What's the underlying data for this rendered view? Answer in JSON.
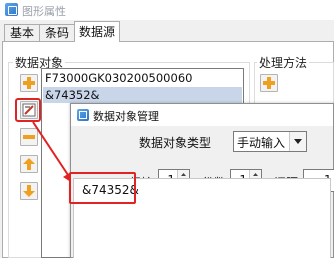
{
  "window": {
    "title": "图形属性",
    "icon": "properties-icon"
  },
  "tabs": [
    {
      "label": "基本",
      "active": false
    },
    {
      "label": "条码",
      "active": false
    },
    {
      "label": "数据源",
      "active": true
    }
  ],
  "data_objects": {
    "group_label": "数据对象",
    "items": [
      {
        "text": "F73000GK030200500060",
        "selected": false
      },
      {
        "text": "&74352&",
        "selected": true
      }
    ],
    "buttons": [
      "add-icon",
      "edit-icon",
      "remove-icon",
      "move-up-icon",
      "move-down-icon"
    ]
  },
  "processing": {
    "group_label": "处理方法",
    "buttons": [
      "add-icon",
      "edit-icon"
    ]
  },
  "dialog": {
    "title": "数据对象管理",
    "type_label": "数据对象类型",
    "type_value": "手动输入",
    "start_label": "起始:",
    "start_value": "1",
    "digits_label": "份数:",
    "digits_value": "1",
    "interval_label": "间隔:",
    "interval_value": "1",
    "content": "&74352&"
  },
  "annotation_color": "#e02424",
  "accent_color": "#2e72c4"
}
